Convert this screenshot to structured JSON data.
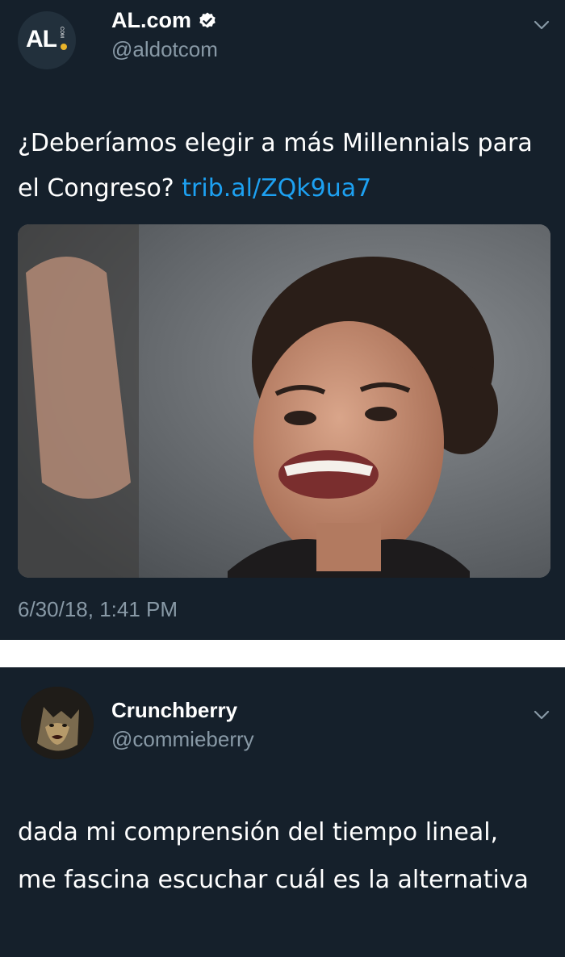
{
  "tweet1": {
    "display_name": "AL.com",
    "handle": "@aldotcom",
    "avatar_text": "AL",
    "avatar_suffix": "COM",
    "text": "¿Deberíamos elegir a más Millennials para el Congreso?",
    "link": "trib.al/ZQk9ua7",
    "timestamp": "6/30/18, 1:41 PM",
    "verified": true
  },
  "tweet2": {
    "display_name": "Crunchberry",
    "handle": "@commieberry",
    "text": "dada mi comprensión del tiempo lineal, me fascina escuchar cuál es la alternativa"
  },
  "colors": {
    "background": "#15202b",
    "link": "#1da1f2",
    "secondary_text": "#8899a6",
    "divider": "#ffffff"
  },
  "icons": [
    "verified-badge-icon",
    "chevron-down-icon"
  ]
}
